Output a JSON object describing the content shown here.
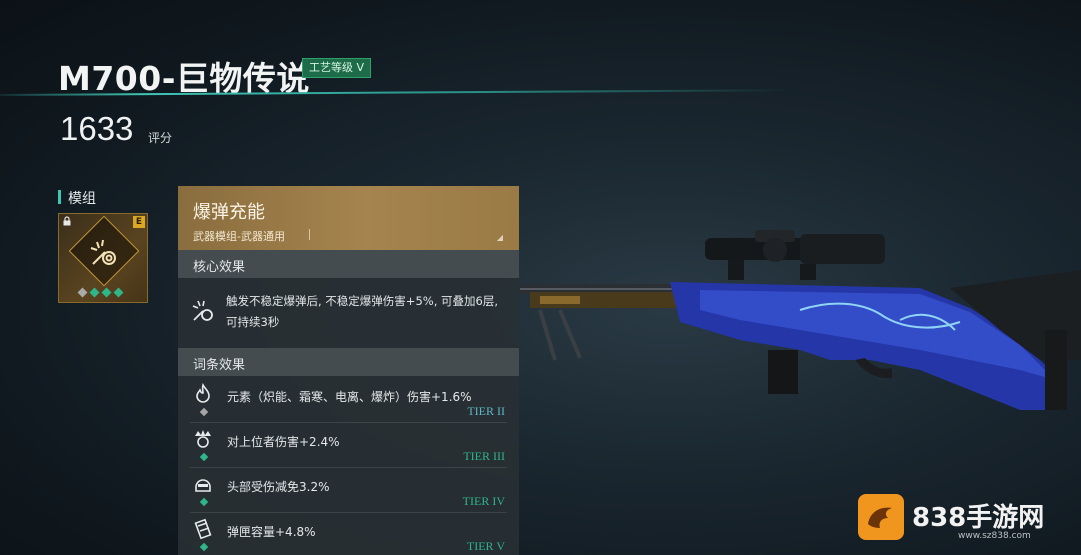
{
  "header": {
    "weapon_name": "M700-巨物传说",
    "craft_grade": "工艺等级 V",
    "score": "1633",
    "score_unit": "评分"
  },
  "module_section": {
    "label": "模组",
    "slot": {
      "rank_badge": "E",
      "icon": "explosive-charge-icon",
      "locked": true,
      "level_dots": {
        "total": 4,
        "filled": 3
      }
    }
  },
  "panel": {
    "title": "爆弹充能",
    "subtitle": "武器模组-武器通用",
    "core_section_label": "核心效果",
    "core_effect": {
      "icon": "explosive-charge-icon",
      "text": "触发不稳定爆弹后, 不稳定爆弹伤害+5%, 可叠加6层, 可持续3秒"
    },
    "affix_section_label": "词条效果",
    "affixes": [
      {
        "icon": "flame-icon",
        "text": "元素（炽能、霜寒、电离、爆炸）伤害+1.6%",
        "tier": "TIER II",
        "gem": "grey"
      },
      {
        "icon": "crown-skull-icon",
        "text": "对上位者伤害+2.4%",
        "tier": "TIER III",
        "gem": "green"
      },
      {
        "icon": "helmet-icon",
        "text": "头部受伤减免3.2%",
        "tier": "TIER IV",
        "gem": "green"
      },
      {
        "icon": "magazine-icon",
        "text": "弹匣容量+4.8%",
        "tier": "TIER V",
        "gem": "green"
      }
    ]
  },
  "watermark": {
    "brand": "838手游网",
    "url": "www.sz838.com"
  },
  "colors": {
    "accent_teal": "#3fc5b4",
    "gold_header": "#a5844e",
    "tier_green": "#2fb58a",
    "tier_blue": "#5fb7c4"
  }
}
